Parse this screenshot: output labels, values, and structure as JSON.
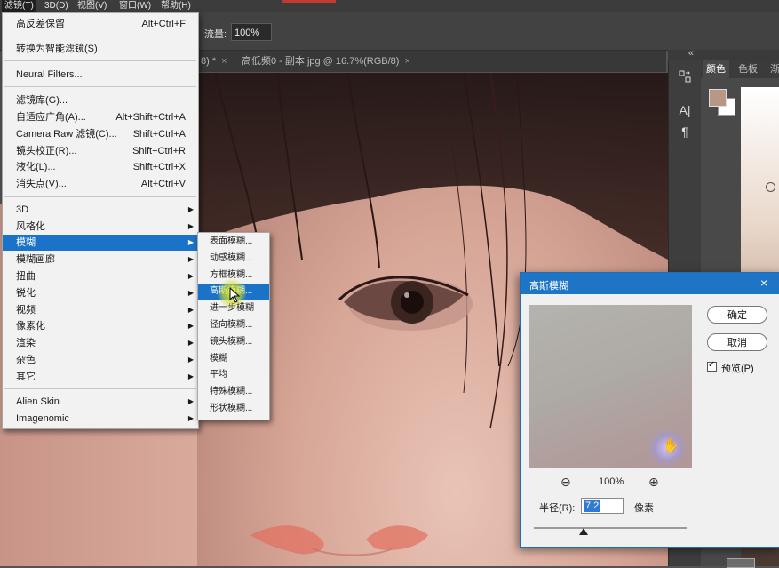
{
  "menubar": {
    "items": [
      "滤镜(T)",
      "3D(D)",
      "视图(V)",
      "窗口(W)",
      "帮助(H)"
    ]
  },
  "options": {
    "flow_label": "流量:",
    "flow_value": "100%"
  },
  "tabs": [
    {
      "label": "8) *",
      "close": "×"
    },
    {
      "label": "高低频0 - 副本.jpg @ 16.7%(RGB/8)",
      "close": "×"
    }
  ],
  "filter_menu": {
    "items": [
      {
        "label": "高反差保留",
        "shortcut": "Alt+Ctrl+F"
      },
      {
        "label": "转换为智能滤镜(S)",
        "shortcut": ""
      },
      {
        "label": "Neural Filters...",
        "shortcut": ""
      },
      {
        "label": "滤镜库(G)...",
        "shortcut": ""
      },
      {
        "label": "自适应广角(A)...",
        "shortcut": "Alt+Shift+Ctrl+A"
      },
      {
        "label": "Camera Raw 滤镜(C)...",
        "shortcut": "Shift+Ctrl+A"
      },
      {
        "label": "镜头校正(R)...",
        "shortcut": "Shift+Ctrl+R"
      },
      {
        "label": "液化(L)...",
        "shortcut": "Shift+Ctrl+X"
      },
      {
        "label": "消失点(V)...",
        "shortcut": "Alt+Ctrl+V"
      },
      {
        "label": "3D",
        "arrow": "▶"
      },
      {
        "label": "风格化",
        "arrow": "▶"
      },
      {
        "label": "模糊",
        "arrow": "▶"
      },
      {
        "label": "模糊画廊",
        "arrow": "▶"
      },
      {
        "label": "扭曲",
        "arrow": "▶"
      },
      {
        "label": "锐化",
        "arrow": "▶"
      },
      {
        "label": "视频",
        "arrow": "▶"
      },
      {
        "label": "像素化",
        "arrow": "▶"
      },
      {
        "label": "渲染",
        "arrow": "▶"
      },
      {
        "label": "杂色",
        "arrow": "▶"
      },
      {
        "label": "其它",
        "arrow": "▶"
      },
      {
        "label": "Alien Skin",
        "arrow": "▶"
      },
      {
        "label": "Imagenomic",
        "arrow": "▶"
      }
    ]
  },
  "blur_submenu": {
    "items": [
      "表面模糊...",
      "动感模糊...",
      "方框模糊...",
      "高斯模糊...",
      "进一步模糊",
      "径向模糊...",
      "镜头模糊...",
      "模糊",
      "平均",
      "特殊模糊...",
      "形状模糊..."
    ]
  },
  "right_panel": {
    "tabs": [
      "颜色",
      "色板",
      "渐"
    ],
    "collapse": "«",
    "tool_icons": [
      "history-icon",
      "type-icon",
      "paragraph-icon"
    ]
  },
  "dialog": {
    "title": "高斯模糊",
    "close": "×",
    "ok": "确定",
    "cancel": "取消",
    "preview_label": "预览(P)",
    "preview_checked": true,
    "zoom_out": "⊖",
    "zoom_value": "100%",
    "zoom_in": "⊕",
    "radius_label": "半径(R):",
    "radius_value": "7.2",
    "radius_unit": "像素",
    "hand_icon": "✋"
  },
  "colors": {
    "menu_highlight": "#1a73c9",
    "dialog_title": "#1e75c6",
    "foreground_swatch": "#b89788",
    "background_swatch": "#ffffff"
  }
}
